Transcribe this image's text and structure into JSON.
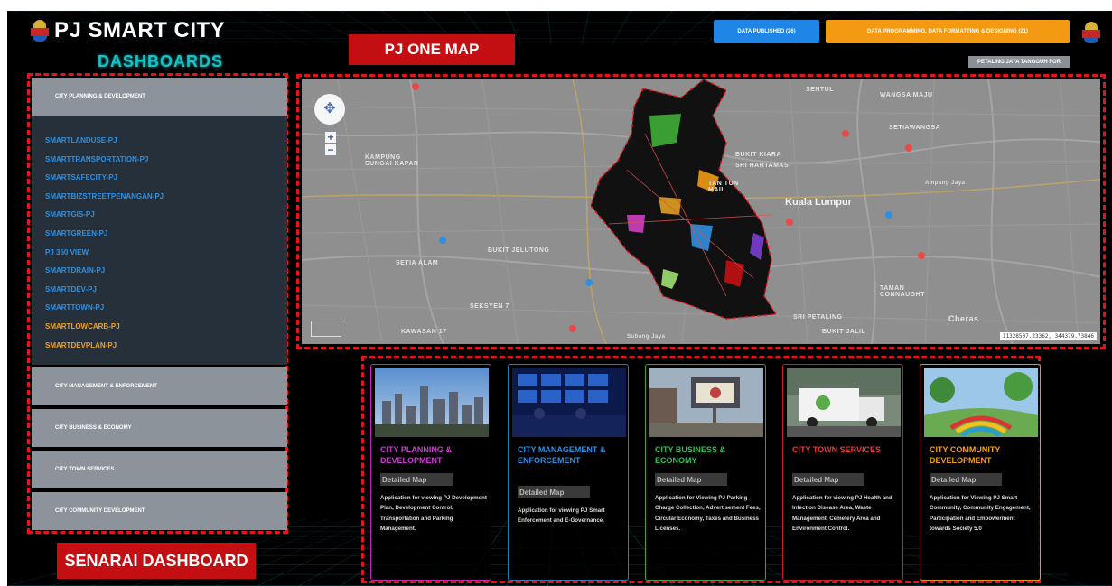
{
  "header": {
    "logo_text": "PJ SMART CITY",
    "dashboards_heading": "DASHBOARDS",
    "map_title": "PJ ONE MAP",
    "data_published_label": "DATA PUBLISHED (26)",
    "data_programming_label": "DATA PROGRAMMING, DATA FORMATTING & DESIGNING (21)",
    "district_tag": "PETALING JAYA TANGGUH FOR"
  },
  "sidebar": {
    "categories": [
      {
        "label": "CITY PLANNING & DEVELOPMENT"
      },
      {
        "label": "CITY MANAGEMENT & ENFORCEMENT"
      },
      {
        "label": "CITY BUSINESS & ECONOMY"
      },
      {
        "label": "CITY TOWN SERVICES"
      },
      {
        "label": "CITY COMMUNITY DEVELOPMENT"
      }
    ],
    "dashboard_links": [
      {
        "label": "SMARTLANDUSE-PJ",
        "color": "blue"
      },
      {
        "label": "SMARTTRANSPORTATION-PJ",
        "color": "blue"
      },
      {
        "label": "SMARTSAFECITY-PJ",
        "color": "blue"
      },
      {
        "label": "SMARTBIZSTREETPENANGAN-PJ",
        "color": "blue"
      },
      {
        "label": "SMARTGIS-PJ",
        "color": "blue"
      },
      {
        "label": "SMARTGREEN-PJ",
        "color": "blue"
      },
      {
        "label": "PJ 360 VIEW",
        "color": "blue"
      },
      {
        "label": "SMARTDRAIN-PJ",
        "color": "blue"
      },
      {
        "label": "SMARTDEV-PJ",
        "color": "blue"
      },
      {
        "label": "SMARTTOWN-PJ",
        "color": "blue"
      },
      {
        "label": "SMARTLOWCARB-PJ",
        "color": "orange"
      },
      {
        "label": "SMARTDEVPLAN-PJ",
        "color": "orange"
      }
    ],
    "senarai_label": "SENARAI DASHBOARD"
  },
  "map": {
    "labels": {
      "sentul": "SENTUL",
      "wangsa_maju": "WANGSA MAJU",
      "setiawangsa": "SETIAWANGSA",
      "kampung_sungai_kapar": "KAMPUNG\nSUNGAI KAPAR",
      "bukit_kiara": "BUKIT KIARA",
      "sri_hartamas": "SRI HARTAMAS",
      "kuala_lumpur": "Kuala Lumpur",
      "ampang_jaya": "Ampang Jaya",
      "setia_alam": "SETIA ALAM",
      "bukit_jelutong": "BUKIT JELUTONG",
      "taman_connaught": "TAMAN\nCONNAUGHT",
      "seksyen_7": "SEKSYEN 7",
      "seri_petaling": "SRI PETALING",
      "bukit_jalil": "BUKIT JALIL",
      "cheras": "Cheras",
      "subang_jaya": "Subang Jaya",
      "kawasan_17": "KAWASAN 17",
      "taman_tun": "TAN TUN\nMAIL"
    },
    "coordinates_readout": "11328507.23362, 344379.73846",
    "zoom_in": "+",
    "zoom_out": "−"
  },
  "cards": [
    {
      "title": "CITY PLANNING & DEVELOPMENT",
      "subtitle": "Detailed Map",
      "description": "Application for viewing PJ Development Plan, Development Control, Transportation and Parking Management."
    },
    {
      "title": "CITY MANAGEMENT & ENFORCEMENT",
      "subtitle": "Detailed Map",
      "description": "Application for viewing PJ Smart Enforcement and E-Governance."
    },
    {
      "title": "CITY BUSINESS & ECONOMY",
      "subtitle": "Detailed Map",
      "description": "Application for Viewing PJ Parking Charge Collection, Advertisement Fees, Circular Economy, Taxes and Business Licenses."
    },
    {
      "title": "CITY TOWN SERVICES",
      "subtitle": "Detailed Map",
      "description": "Application for viewing PJ Health and Infection Disease Area, Waste Management, Cemetery Area and Environment Control."
    },
    {
      "title": "CITY COMMUNITY DEVELOPMENT",
      "subtitle": "Detailed Map",
      "description": "Application for Viewing PJ Smart Community, Community Engagement, Participation and Empowerment towards Society 5.0"
    }
  ],
  "colors": {
    "accent_red": "#c30f12",
    "teal": "#16c3c8",
    "blue_button": "#1f86e8",
    "orange_button": "#f39a12",
    "purple_card": "#c93fd0",
    "blue_card": "#2f8fe0",
    "green_card": "#2fc05a",
    "red_card": "#e83a3a",
    "orange_card": "#f0a020"
  },
  "icons": [
    "emblem-icon",
    "pan-control-icon",
    "zoom-in-icon",
    "zoom-out-icon",
    "map-pin-icon"
  ]
}
